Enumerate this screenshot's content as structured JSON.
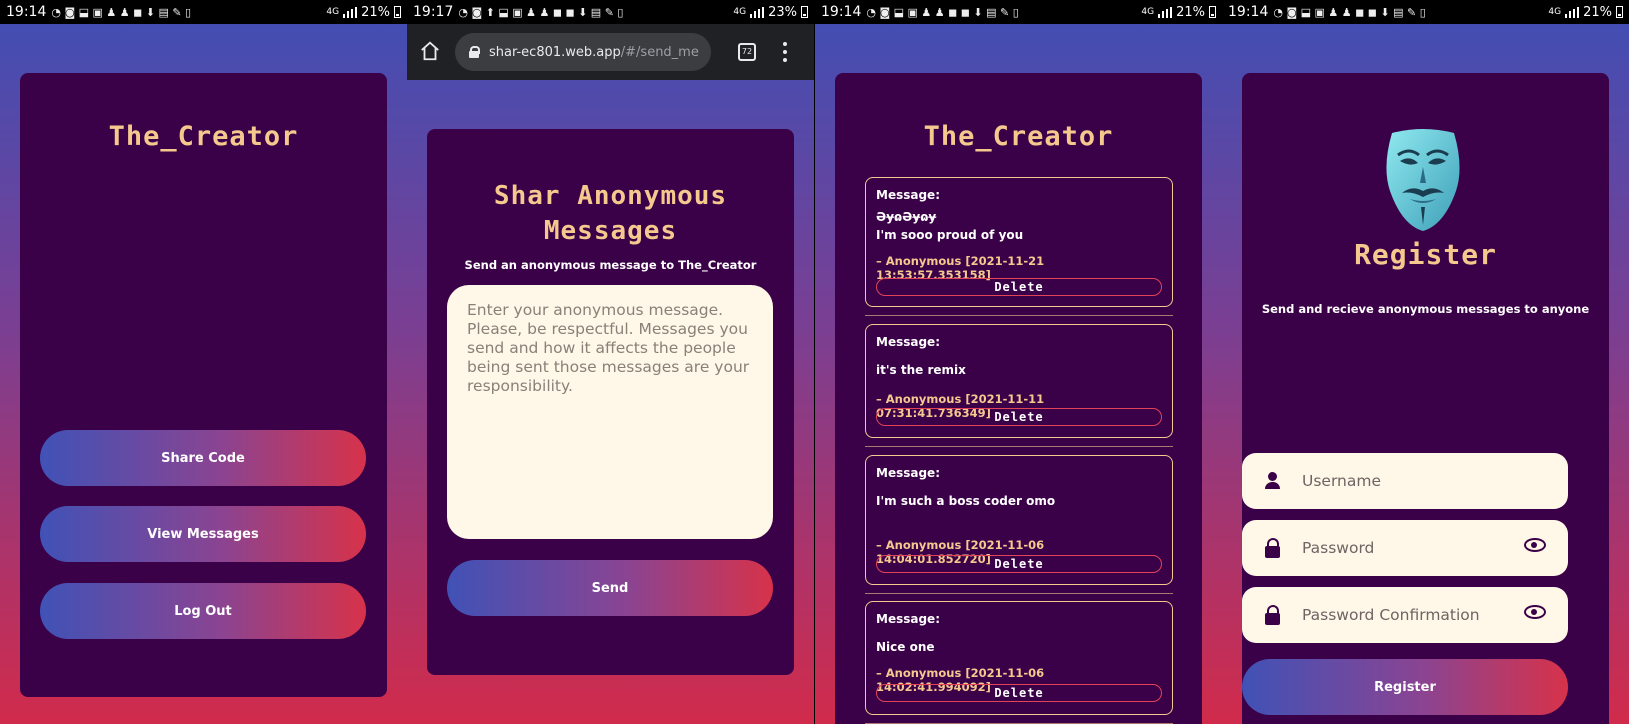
{
  "screens": {
    "home": {
      "status": {
        "time": "19:14",
        "network": "4G",
        "battery": "21%"
      },
      "title": "The_Creator",
      "buttons": {
        "share": "Share Code",
        "view": "View Messages",
        "logout": "Log Out"
      }
    },
    "send": {
      "status": {
        "time": "19:17",
        "network": "4G",
        "battery": "23%"
      },
      "url": {
        "host": "shar-ec801.web.app",
        "path": "/#/send_me"
      },
      "tab_count": "72",
      "title_line1": "Shar Anonymous",
      "title_line2": "Messages",
      "subtitle": "Send an anonymous message to The_Creator",
      "message_placeholder": "Enter your anonymous message. Please, be respectful. Messages you send and how it affects the people being sent those messages are your responsibility.",
      "send_label": "Send"
    },
    "messages": {
      "status": {
        "time": "19:14",
        "network": "4G",
        "battery": "21%"
      },
      "title": "The_Creator",
      "message_label": "Message:",
      "delete_label": "Delete",
      "items": [
        {
          "line1": "ƏɏɷƏɏɷɏ",
          "line2": "I'm sooo proud of you",
          "meta": "– Anonymous [2021-11-21 13:53:57.353158]"
        },
        {
          "line1": "it's the remix",
          "line2": "",
          "meta": "– Anonymous [2021-11-11 07:31:41.736349]"
        },
        {
          "line1": "I'm such a boss coder omo",
          "line2": "",
          "meta": "– Anonymous [2021-11-06 14:04:01.852720]"
        },
        {
          "line1": "Nice one",
          "line2": "",
          "meta": "– Anonymous [2021-11-06 14:02:41.994092]"
        }
      ]
    },
    "register": {
      "status": {
        "time": "19:14",
        "network": "4G",
        "battery": "21%"
      },
      "title": "Register",
      "subtitle": "Send and recieve anonymous messages to anyone",
      "username_placeholder": "Username",
      "password_placeholder": "Password",
      "confirm_placeholder": "Password Confirmation",
      "register_label": "Register"
    }
  },
  "colors": {
    "card": "#3b0148",
    "accent": "#f5c98e",
    "field": "#fff8e8",
    "gradient_start": "#4052b6",
    "gradient_end": "#d7324a"
  },
  "icons": [
    "person-icon",
    "lock-icon",
    "eye-icon",
    "home-icon",
    "tab-switcher-icon",
    "more-vert-icon",
    "guy-fawkes-mask-logo"
  ]
}
